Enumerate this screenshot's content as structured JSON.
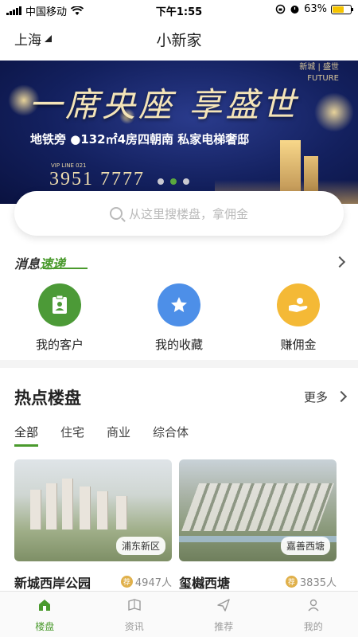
{
  "status_bar": {
    "carrier": "中国移动",
    "time": "下午1:55",
    "battery": "63%",
    "battery_level": 0.63
  },
  "nav": {
    "city": "上海",
    "title": "小新家"
  },
  "banner": {
    "headline": "一席央座 享盛世",
    "brand_line1": "新城 | 盛世",
    "brand_line2": "FUTURE",
    "subline": "地铁旁 ●132㎡4房四朝南 私家电梯奢邸",
    "vip": "VIP LINE 021",
    "phone": "3951 7777",
    "active_dot": 1
  },
  "search": {
    "placeholder": "从这里搜楼盘，拿佣金"
  },
  "news": {
    "label_a": "消息",
    "label_b": "速递"
  },
  "quick_actions": [
    {
      "label": "我的客户",
      "color": "#4c9a37",
      "icon": "client-card-icon"
    },
    {
      "label": "我的收藏",
      "color": "#4d8fe8",
      "icon": "star-icon"
    },
    {
      "label": "赚佣金",
      "color": "#f4b936",
      "icon": "hand-coin-icon"
    }
  ],
  "hot": {
    "title": "热点楼盘",
    "more": "更多",
    "tabs": [
      "全部",
      "住宅",
      "商业",
      "综合体"
    ],
    "cards": [
      {
        "name": "新城西岸公园",
        "district": "浦东新区",
        "count": "4947人"
      },
      {
        "name": "玺樾西塘",
        "district": "嘉善西塘",
        "count": "3835人"
      }
    ],
    "coin_glyph": "荐"
  },
  "tabbar": [
    {
      "label": "楼盘",
      "icon": "home-icon",
      "active": true
    },
    {
      "label": "资讯",
      "icon": "news-icon",
      "active": false
    },
    {
      "label": "推荐",
      "icon": "send-icon",
      "active": false
    },
    {
      "label": "我的",
      "icon": "profile-icon",
      "active": false
    }
  ],
  "colors": {
    "accent": "#4a9a2d"
  }
}
